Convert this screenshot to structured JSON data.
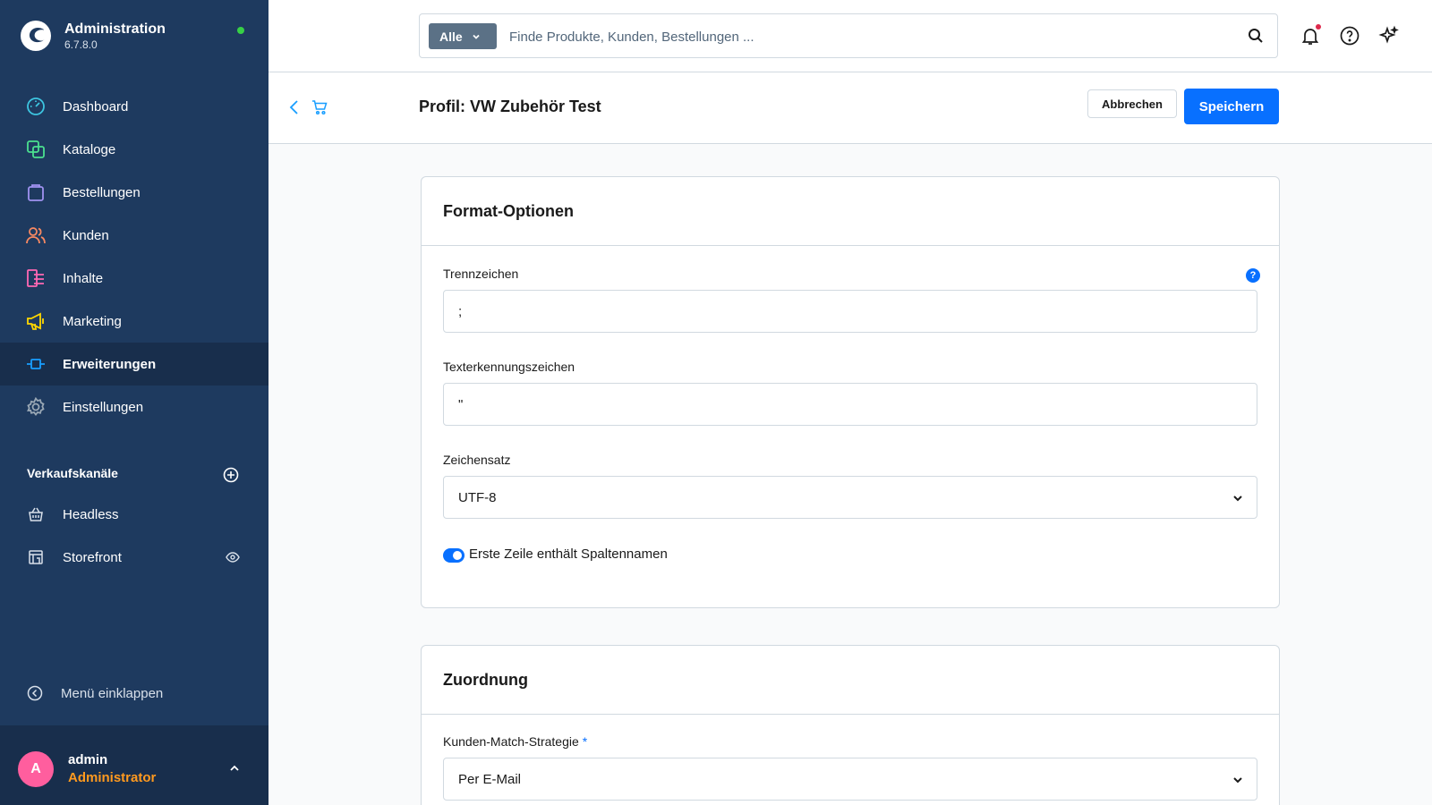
{
  "colors": {
    "sidebar_bg": "#1e3a5f",
    "accent": "#0870ff",
    "online": "#37d046",
    "role": "#ff9a1f",
    "avatar": "#ff5e9e"
  },
  "brand": {
    "title": "Administration",
    "version": "6.7.8.0"
  },
  "nav": [
    {
      "label": "Dashboard",
      "icon": "dashboard-icon",
      "color": "#3dc5e0"
    },
    {
      "label": "Kataloge",
      "icon": "catalog-icon",
      "color": "#4be08f"
    },
    {
      "label": "Bestellungen",
      "icon": "orders-icon",
      "color": "#a092f0"
    },
    {
      "label": "Kunden",
      "icon": "customers-icon",
      "color": "#f88962"
    },
    {
      "label": "Inhalte",
      "icon": "content-icon",
      "color": "#ff68b4"
    },
    {
      "label": "Marketing",
      "icon": "marketing-icon",
      "color": "#ffd700"
    },
    {
      "label": "Erweiterungen",
      "icon": "extensions-icon",
      "color": "#189eff",
      "active": true
    },
    {
      "label": "Einstellungen",
      "icon": "settings-icon",
      "color": "#9aa8b5"
    }
  ],
  "sales_channels": {
    "title": "Verkaufskanäle",
    "items": [
      {
        "label": "Headless",
        "icon": "headless-icon"
      },
      {
        "label": "Storefront",
        "icon": "storefront-icon"
      }
    ]
  },
  "collapse_label": "Menü einklappen",
  "user": {
    "initial": "A",
    "name": "admin",
    "role": "Administrator"
  },
  "search": {
    "type_label": "Alle",
    "placeholder": "Finde Produkte, Kunden, Bestellungen ..."
  },
  "smartbar": {
    "title": "Profil: VW Zubehör Test",
    "cancel_label": "Abbrechen",
    "save_label": "Speichern"
  },
  "format_card": {
    "title": "Format-Optionen",
    "separator": {
      "label": "Trennzeichen",
      "value": ";",
      "help": "?"
    },
    "enclosure": {
      "label": "Texterkennungszeichen",
      "value": "\""
    },
    "charset": {
      "label": "Zeichensatz",
      "value": "UTF-8"
    },
    "header_row": {
      "label": "Erste Zeile enthält Spaltennamen",
      "checked": true
    }
  },
  "mapping_card": {
    "title": "Zuordnung",
    "strategy": {
      "label": "Kunden-Match-Strategie",
      "required": "*",
      "value": "Per E-Mail"
    }
  }
}
